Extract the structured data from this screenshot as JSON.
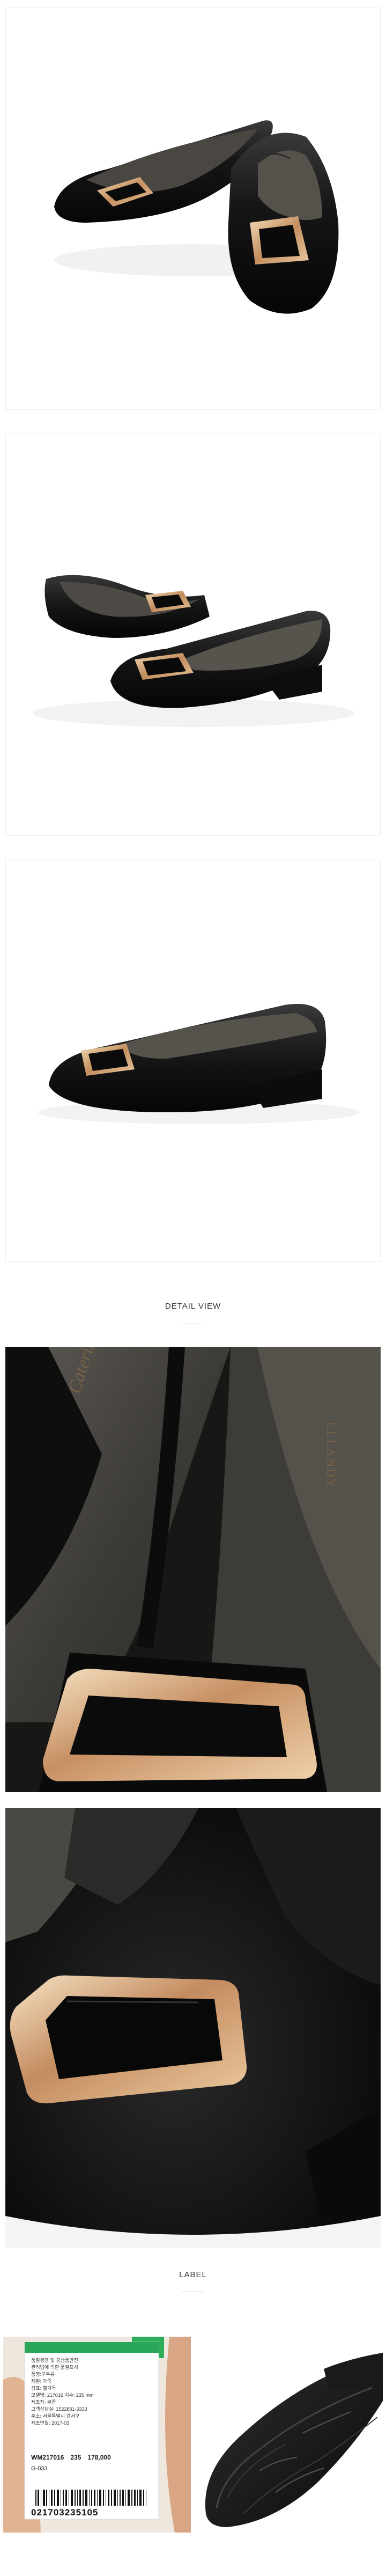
{
  "sections": {
    "detail_heading": "DETAIL VIEW",
    "label_heading": "LABEL"
  },
  "insole_brand": "Caterina",
  "insole_brand_side": "ELLANDY",
  "tag": {
    "lines": [
      "품질경영 및 공산품안전",
      "관리법에 의한 품질표시",
      "품명:구두류",
      "재질: 가죽",
      "상표: 헬기득",
      "모델명: 217016   치수: 235 mm",
      "제조자: 부중",
      "고객상담실: 1522881-3333",
      "주소: 서울특별시 강서구",
      "제조연월: 2017-03"
    ],
    "model": "WM217016",
    "size": "235",
    "price": "178,000",
    "code": "G-033",
    "barcode_number": "021703235105"
  },
  "colors": {
    "leather": "#141414",
    "gold": "#c9a070",
    "lining": "#5a5650",
    "page_bg": "#ffffff"
  }
}
